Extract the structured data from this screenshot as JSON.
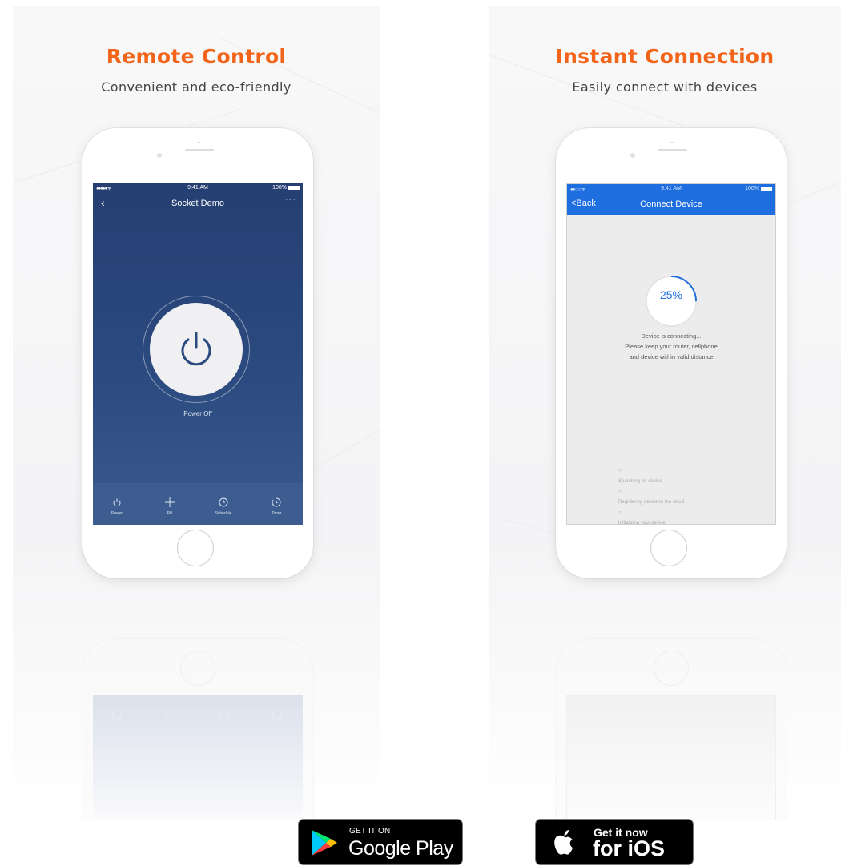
{
  "panels": {
    "left": {
      "headline": "Remote Control",
      "subhead": "Convenient and eco-friendly",
      "screen": {
        "status_signal": "●●●●● ᯤ",
        "status_time": "9:41 AM",
        "status_battery": "100%",
        "nav_back_icon": "chevron-left-icon",
        "nav_title": "Socket Demo",
        "nav_more": "···",
        "power_state": "Power Off",
        "tabs": [
          {
            "label": "Power",
            "icon": "power-icon"
          },
          {
            "label": "Pill",
            "icon": "plus-icon"
          },
          {
            "label": "Schedule",
            "icon": "clock-icon"
          },
          {
            "label": "Timer",
            "icon": "timer-icon"
          }
        ]
      }
    },
    "right": {
      "headline": "Instant Connection",
      "subhead": "Easily connect with devices",
      "screen": {
        "status_signal": "●●○○○ ᯤ",
        "status_time": "9:41 AM",
        "status_battery": "100%",
        "back_label": "<Back",
        "nav_title": "Connect Device",
        "progress_text": "25%",
        "progress_value": 0.25,
        "message_line1": "Device is connecting...",
        "message_line2": "Please keep your router, cellphone",
        "message_line3": "and device within valid distance",
        "steps": [
          "Searching for device",
          "Registering device to the cloud",
          "Initializing your device"
        ]
      }
    }
  },
  "stores": {
    "google": {
      "small": "GET IT ON",
      "big": "Google Play"
    },
    "apple": {
      "small": "Get it now",
      "big": "for iOS"
    }
  },
  "colors": {
    "headline": "#f26419",
    "dark_screen": "#2b4a7f",
    "blue_bar": "#1f6ee0"
  }
}
